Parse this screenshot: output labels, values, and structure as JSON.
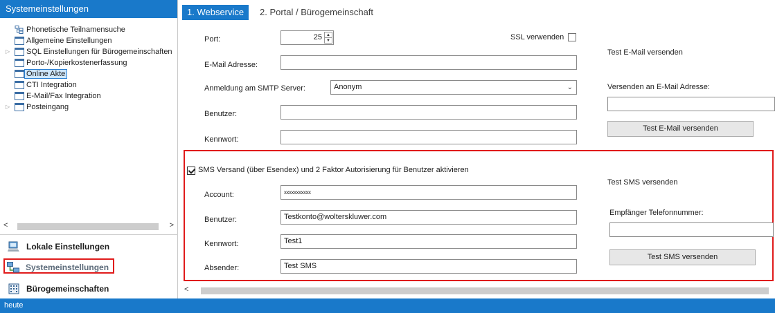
{
  "left_panel": {
    "title": "Systemeinstellungen",
    "tree": [
      {
        "label": "Phonetische Teilnamensuche",
        "icon": "tree-structure-icon",
        "expandable": false,
        "selected": false
      },
      {
        "label": "Allgemeine Einstellungen",
        "icon": "folder-icon",
        "expandable": false,
        "selected": false
      },
      {
        "label": "SQL Einstellungen für Bürogemeinschaften",
        "icon": "folder-icon",
        "expandable": true,
        "selected": false
      },
      {
        "label": "Porto-/Kopierkostenerfassung",
        "icon": "folder-icon",
        "expandable": false,
        "selected": false
      },
      {
        "label": "Online Akte",
        "icon": "folder-icon",
        "expandable": false,
        "selected": true
      },
      {
        "label": "CTI Integration",
        "icon": "folder-icon",
        "expandable": false,
        "selected": false
      },
      {
        "label": "E-Mail/Fax Integration",
        "icon": "folder-icon",
        "expandable": false,
        "selected": false
      },
      {
        "label": "Posteingang",
        "icon": "folder-icon",
        "expandable": true,
        "selected": false
      }
    ],
    "nav": [
      {
        "label": "Lokale Einstellungen",
        "icon": "computer-icon",
        "active": false
      },
      {
        "label": "Systemeinstellungen",
        "icon": "network-icon",
        "active": true
      },
      {
        "label": "Bürogemeinschaften",
        "icon": "building-icon",
        "active": false
      }
    ]
  },
  "tabs": [
    {
      "label": "1. Webservice",
      "active": true
    },
    {
      "label": "2. Portal / Bürogemeinschaft",
      "active": false
    }
  ],
  "webservice": {
    "port_label": "Port:",
    "port_value": "25",
    "ssl_label": "SSL verwenden",
    "ssl_checked": false,
    "email_label": "E-Mail Adresse:",
    "email_value": "",
    "smtp_label": "Anmeldung am SMTP Server:",
    "smtp_value": "Anonym",
    "user_label": "Benutzer:",
    "user_value": "",
    "password_label": "Kennwort:",
    "password_value": ""
  },
  "test_email": {
    "title": "Test E-Mail versenden",
    "to_label": "Versenden an E-Mail Adresse:",
    "to_value": "",
    "button": "Test E-Mail versenden"
  },
  "sms": {
    "checkbox_label": "SMS Versand (über Esendex) und 2 Faktor Autorisierung für Benutzer aktivieren",
    "checked": true,
    "account_label": "Account:",
    "account_value": "xxxxxxxxxxx",
    "user_label": "Benutzer:",
    "user_value": "Testkonto@wolterskluwer.com",
    "password_label": "Kennwort:",
    "password_value": "Test1",
    "sender_label": "Absender:",
    "sender_value": "Test SMS"
  },
  "test_sms": {
    "title": "Test SMS versenden",
    "phone_label": "Empfänger Telefonnummer:",
    "phone_value": "",
    "button": "Test SMS versenden"
  },
  "status_bar": {
    "text": "heute"
  },
  "colors": {
    "accent": "#1979ca",
    "highlight_border": "#e01a1a"
  }
}
